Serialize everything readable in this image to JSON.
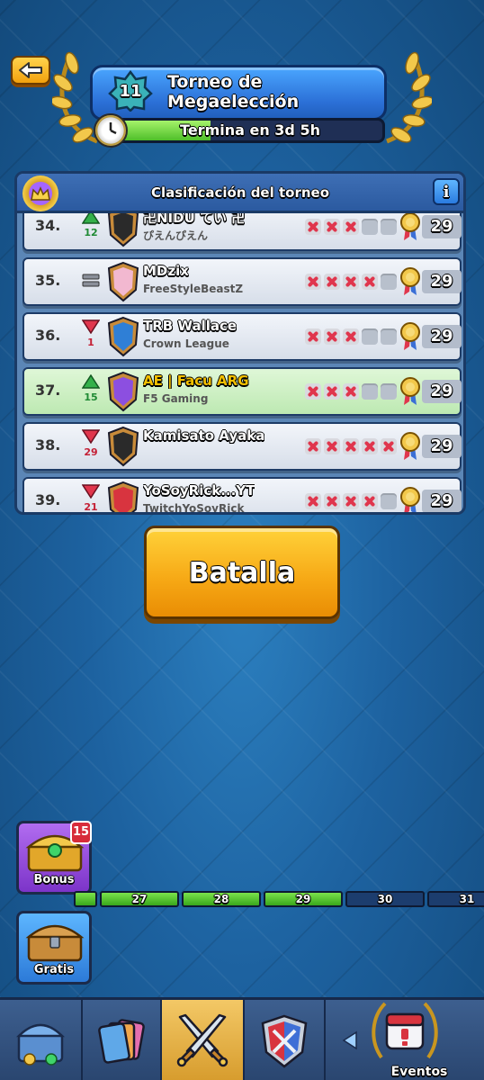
{
  "header": {
    "level": "11",
    "title_line1": "Torneo de",
    "title_line2": "Megaelección",
    "timer_text": "Termina en 3d 5h",
    "timer_progress": 0.35
  },
  "leaderboard": {
    "title": "Clasificación del torneo",
    "info_label": "i",
    "rows": [
      {
        "rank": "34.",
        "trend": "up",
        "trend_value": "12",
        "name": "卍NIDU てい 卍",
        "clan": "ぴえんぴえん",
        "results": [
          "loss",
          "loss",
          "loss",
          "empty",
          "empty"
        ],
        "score": "29",
        "shield_color": "#2a2a2a",
        "highlight": false
      },
      {
        "rank": "35.",
        "trend": "same",
        "trend_value": "",
        "name": "MDzix",
        "clan": "FreeStyleBeastZ",
        "results": [
          "loss",
          "loss",
          "loss",
          "loss",
          "empty"
        ],
        "score": "29",
        "shield_color": "#f2b8d0",
        "highlight": false
      },
      {
        "rank": "36.",
        "trend": "down",
        "trend_value": "1",
        "name": "TRB Wallace",
        "clan": "Crown League",
        "results": [
          "loss",
          "loss",
          "loss",
          "empty",
          "empty"
        ],
        "score": "29",
        "shield_color": "#2f7fd6",
        "highlight": false
      },
      {
        "rank": "37.",
        "trend": "up",
        "trend_value": "15",
        "name": "AE | Facu ARG",
        "clan": "F5 Gaming",
        "results": [
          "loss",
          "loss",
          "loss",
          "empty",
          "empty"
        ],
        "score": "29",
        "shield_color": "#8c4fe0",
        "highlight": true
      },
      {
        "rank": "38.",
        "trend": "down",
        "trend_value": "29",
        "name": "Kamisato Ayaka",
        "clan": "",
        "results": [
          "loss",
          "loss",
          "loss",
          "loss",
          "loss"
        ],
        "score": "29",
        "shield_color": "#2a2a2a",
        "highlight": false
      },
      {
        "rank": "39.",
        "trend": "down",
        "trend_value": "21",
        "name": "YoSoyRick...YT",
        "clan": "TwitchYoSoyRick",
        "results": [
          "loss",
          "loss",
          "loss",
          "loss",
          "empty"
        ],
        "score": "29",
        "shield_color": "#d8343f",
        "highlight": false
      }
    ]
  },
  "battle_button": "Batalla",
  "chests": {
    "bonus_label": "Bonus",
    "bonus_count": "15",
    "free_label": "Gratis"
  },
  "track": [
    {
      "label": "",
      "state": "done"
    },
    {
      "label": "27",
      "state": "done"
    },
    {
      "label": "28",
      "state": "done"
    },
    {
      "label": "29",
      "state": "done"
    },
    {
      "label": "30",
      "state": "todo"
    },
    {
      "label": "31",
      "state": "todo"
    }
  ],
  "nav": {
    "events_label": "Eventos",
    "items": [
      "shop-icon",
      "cards-icon",
      "battle-swords-icon",
      "clan-icon",
      "events-calendar-icon"
    ]
  }
}
